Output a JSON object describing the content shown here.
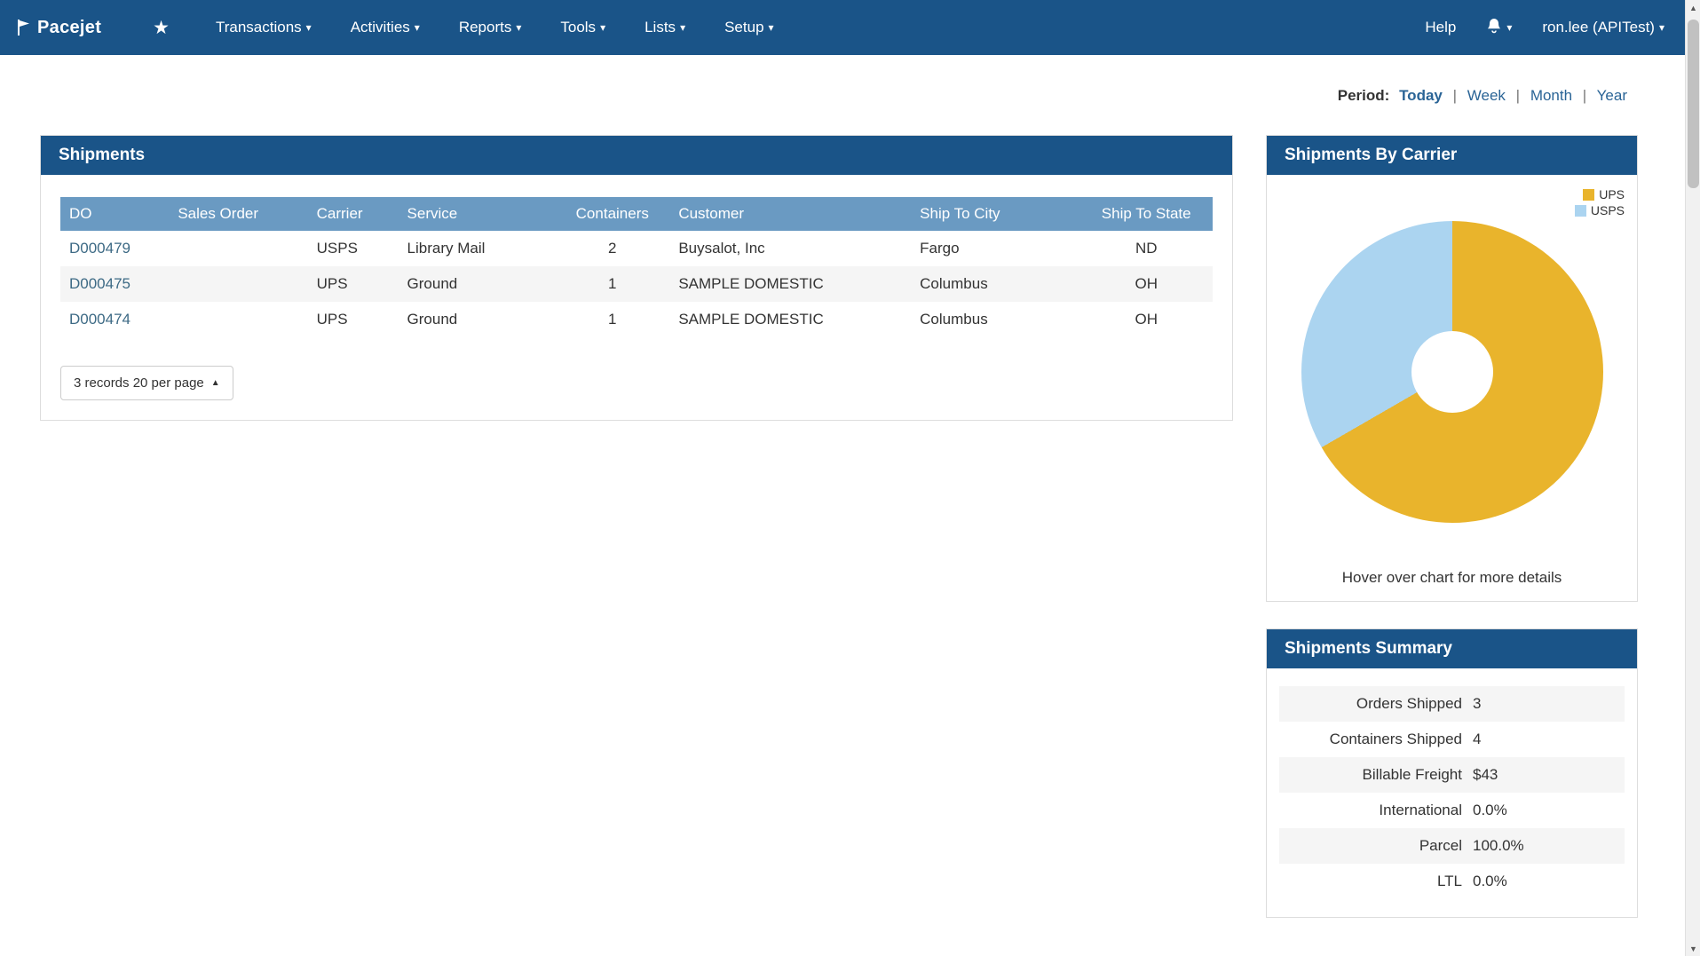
{
  "navbar": {
    "brand": "Pacejet",
    "items": [
      {
        "label": "Transactions"
      },
      {
        "label": "Activities"
      },
      {
        "label": "Reports"
      },
      {
        "label": "Tools"
      },
      {
        "label": "Lists"
      },
      {
        "label": "Setup"
      }
    ],
    "help": "Help",
    "user": "ron.lee (APITest)"
  },
  "period": {
    "label": "Period:",
    "options": [
      "Today",
      "Week",
      "Month",
      "Year"
    ],
    "selected": "Today"
  },
  "shipments": {
    "title": "Shipments",
    "columns": [
      "DO",
      "Sales Order",
      "Carrier",
      "Service",
      "Containers",
      "Customer",
      "Ship To City",
      "Ship To State"
    ],
    "rows": [
      {
        "do": "D000479",
        "sales_order": "",
        "carrier": "USPS",
        "service": "Library Mail",
        "containers": "2",
        "customer": "Buysalot, Inc",
        "city": "Fargo",
        "state": "ND"
      },
      {
        "do": "D000475",
        "sales_order": "",
        "carrier": "UPS",
        "service": "Ground",
        "containers": "1",
        "customer": "SAMPLE DOMESTIC",
        "city": "Columbus",
        "state": "OH"
      },
      {
        "do": "D000474",
        "sales_order": "",
        "carrier": "UPS",
        "service": "Ground",
        "containers": "1",
        "customer": "SAMPLE DOMESTIC",
        "city": "Columbus",
        "state": "OH"
      }
    ],
    "pagination": "3 records 20 per page"
  },
  "carrier_chart": {
    "title": "Shipments By Carrier",
    "hint": "Hover over chart for more details",
    "legend": [
      {
        "label": "UPS",
        "color": "#e9b42c"
      },
      {
        "label": "USPS",
        "color": "#abd4f0"
      }
    ]
  },
  "chart_data": {
    "type": "pie",
    "subtype": "donut",
    "title": "Shipments By Carrier",
    "labels": [
      "UPS",
      "USPS"
    ],
    "values": [
      2,
      1
    ],
    "percentages": [
      66.7,
      33.3
    ],
    "colors": [
      "#e9b42c",
      "#abd4f0"
    ],
    "legend_position": "top-right"
  },
  "summary": {
    "title": "Shipments Summary",
    "rows": [
      {
        "label": "Orders Shipped",
        "value": "3"
      },
      {
        "label": "Containers Shipped",
        "value": "4"
      },
      {
        "label": "Billable Freight",
        "value": "$43"
      },
      {
        "label": "International",
        "value": "0.0%"
      },
      {
        "label": "Parcel",
        "value": "100.0%"
      },
      {
        "label": "LTL",
        "value": "0.0%"
      }
    ]
  },
  "colors": {
    "navbar": "#1a5488",
    "table_header": "#6a9ac2",
    "link": "#2a6496"
  }
}
